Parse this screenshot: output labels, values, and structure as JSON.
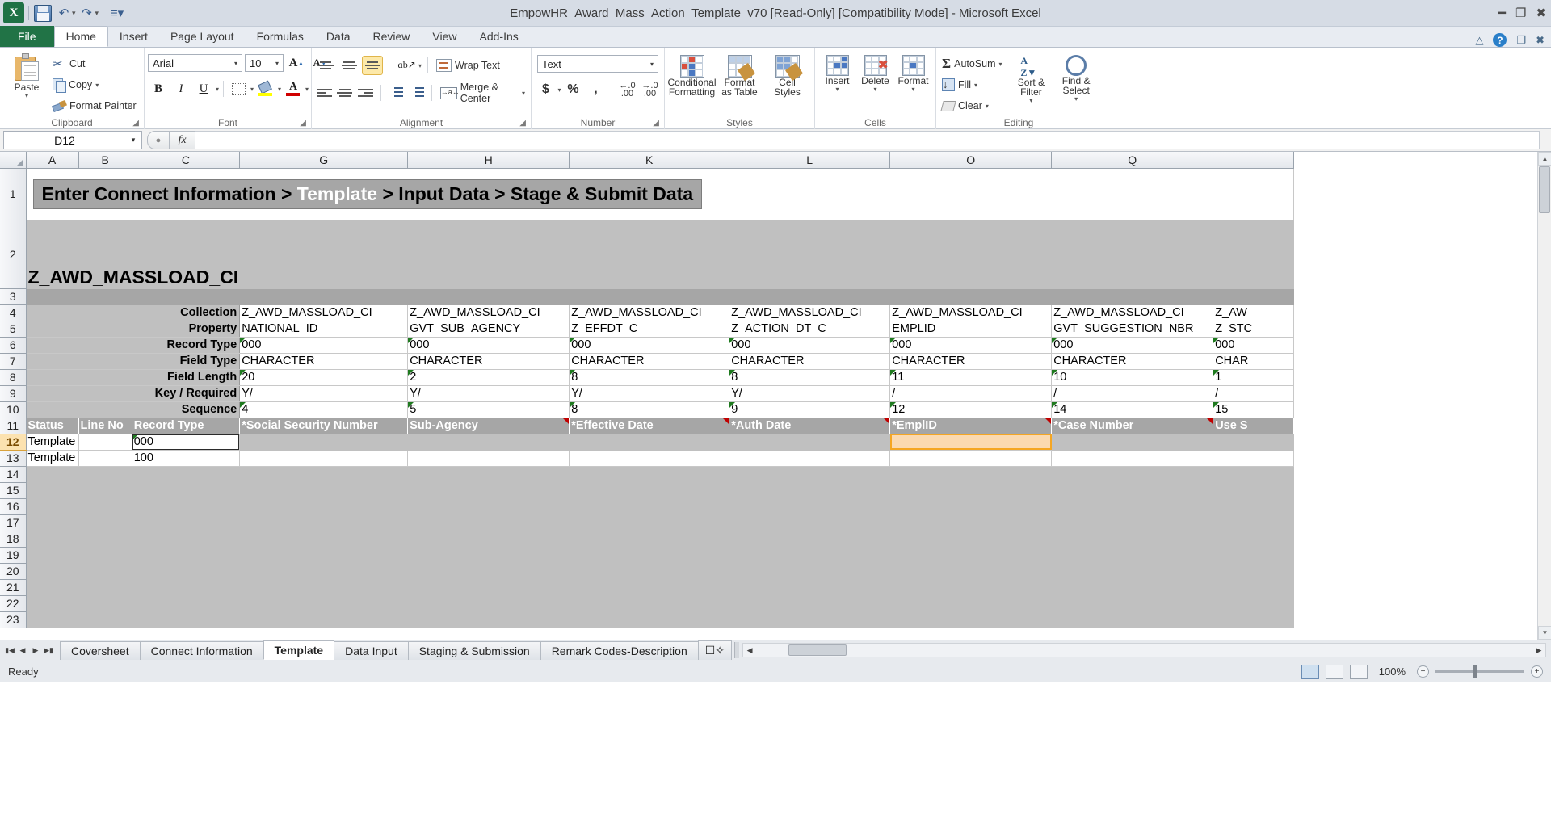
{
  "titlebar": {
    "doc_title": "EmpowHR_Award_Mass_Action_Template_v70  [Read-Only]  [Compatibility Mode] - Microsoft Excel",
    "qat": [
      "save-icon",
      "undo-icon",
      "redo-icon",
      "customize-qat-icon"
    ],
    "window_controls": [
      "minimize",
      "restore",
      "close"
    ]
  },
  "ribbon_tabs": {
    "file": "File",
    "items": [
      "Home",
      "Insert",
      "Page Layout",
      "Formulas",
      "Data",
      "Review",
      "View",
      "Add-Ins"
    ],
    "active": "Home"
  },
  "ribbon": {
    "clipboard": {
      "label": "Clipboard",
      "paste": "Paste",
      "cut": "Cut",
      "copy": "Copy",
      "format_painter": "Format Painter"
    },
    "font": {
      "label": "Font",
      "font_name": "Arial",
      "font_size": "10",
      "bold": "B",
      "italic": "I",
      "underline": "U"
    },
    "alignment": {
      "label": "Alignment",
      "wrap_text": "Wrap Text",
      "merge_center": "Merge & Center"
    },
    "number": {
      "label": "Number",
      "format": "Text",
      "currency": "$",
      "percent": "%",
      "comma": ","
    },
    "styles": {
      "label": "Styles",
      "conditional_formatting": "Conditional\nFormatting",
      "conditional_formatting_l1": "Conditional",
      "conditional_formatting_l2": "Formatting",
      "format_as_table_l1": "Format",
      "format_as_table_l2": "as Table",
      "cell_styles_l1": "Cell",
      "cell_styles_l2": "Styles"
    },
    "cells": {
      "label": "Cells",
      "insert": "Insert",
      "delete": "Delete",
      "format": "Format"
    },
    "editing": {
      "label": "Editing",
      "autosum": "AutoSum",
      "fill": "Fill",
      "clear": "Clear",
      "sort_filter_l1": "Sort &",
      "sort_filter_l2": "Filter",
      "find_select_l1": "Find &",
      "find_select_l2": "Select"
    }
  },
  "formula_bar": {
    "name_box": "D12",
    "formula": ""
  },
  "grid": {
    "column_headers": [
      "A",
      "B",
      "C",
      "G",
      "H",
      "K",
      "L",
      "O",
      "Q"
    ],
    "row_numbers": [
      "1",
      "2",
      "3",
      "4",
      "5",
      "6",
      "7",
      "8",
      "9",
      "10",
      "11",
      "12",
      "13",
      "14",
      "15",
      "16",
      "17",
      "18",
      "19",
      "20",
      "21",
      "22",
      "23"
    ],
    "selected_cell": "D12",
    "banner": {
      "prefix": "Enter Connect Information > ",
      "highlight": "Template",
      "suffix": " > Input Data > Stage & Submit Data"
    },
    "sheet_title": "Z_AWD_MASSLOAD_CI",
    "meta_labels": [
      "Collection",
      "Property",
      "Record Type",
      "Field Type",
      "Field Length",
      "Key / Required",
      "Sequence"
    ],
    "meta_rows": [
      {
        "label": "Collection",
        "row": "4",
        "values": [
          "Z_AWD_MASSLOAD_CI",
          "Z_AWD_MASSLOAD_CI",
          "Z_AWD_MASSLOAD_CI",
          "Z_AWD_MASSLOAD_CI",
          "Z_AWD_MASSLOAD_CI",
          "Z_AWD_MASSLOAD_CI",
          "Z_AW"
        ]
      },
      {
        "label": "Property",
        "row": "5",
        "values": [
          "NATIONAL_ID",
          "GVT_SUB_AGENCY",
          "Z_EFFDT_C",
          "Z_ACTION_DT_C",
          "EMPLID",
          "GVT_SUGGESTION_NBR",
          "Z_STC"
        ]
      },
      {
        "label": "Record Type",
        "row": "6",
        "values": [
          "000",
          "000",
          "000",
          "000",
          "000",
          "000",
          "000"
        ]
      },
      {
        "label": "Field Type",
        "row": "7",
        "values": [
          "CHARACTER",
          "CHARACTER",
          "CHARACTER",
          "CHARACTER",
          "CHARACTER",
          "CHARACTER",
          "CHAR"
        ]
      },
      {
        "label": "Field Length",
        "row": "8",
        "values": [
          "20",
          "2",
          "8",
          "8",
          "11",
          "10",
          "1"
        ]
      },
      {
        "label": "Key / Required",
        "row": "9",
        "values": [
          "Y/",
          "Y/",
          "Y/",
          "Y/",
          "/",
          "/",
          "/"
        ]
      },
      {
        "label": "Sequence",
        "row": "10",
        "values": [
          "4",
          "5",
          "8",
          "9",
          "12",
          "14",
          "15"
        ]
      }
    ],
    "header_row": {
      "row": "11",
      "cells": [
        "Status",
        "Line No",
        "Record Type",
        "*Social Security Number",
        "Sub-Agency",
        "*Effective Date",
        "*Auth Date",
        "*EmplID",
        "*Case Number",
        "Use S"
      ]
    },
    "data_rows": [
      {
        "row": "12",
        "status": "Template",
        "line_no": "",
        "record_type": "000"
      },
      {
        "row": "13",
        "status": "Template",
        "line_no": "",
        "record_type": "100"
      }
    ],
    "empty_rows": [
      "14",
      "15",
      "16",
      "17",
      "18",
      "19",
      "20",
      "21",
      "22",
      "23"
    ]
  },
  "sheet_tabs": {
    "items": [
      "Coversheet",
      "Connect Information",
      "Template",
      "Data Input",
      "Staging & Submission",
      "Remark Codes-Description"
    ],
    "active": "Template",
    "new_sheet_icon": "new-sheet-icon"
  },
  "status_bar": {
    "mode": "Ready",
    "zoom": "100%",
    "views": [
      "normal-view-icon",
      "page-layout-view-icon",
      "page-break-view-icon"
    ],
    "active_view": "normal-view-icon"
  },
  "colors": {
    "excel_green": "#217346",
    "banner_gray": "#a6a6a6",
    "cell_gray": "#c0c0c0",
    "selection_orange": "#f5a623",
    "comment_red": "#c00000",
    "formula_green": "#1f7a1f"
  }
}
